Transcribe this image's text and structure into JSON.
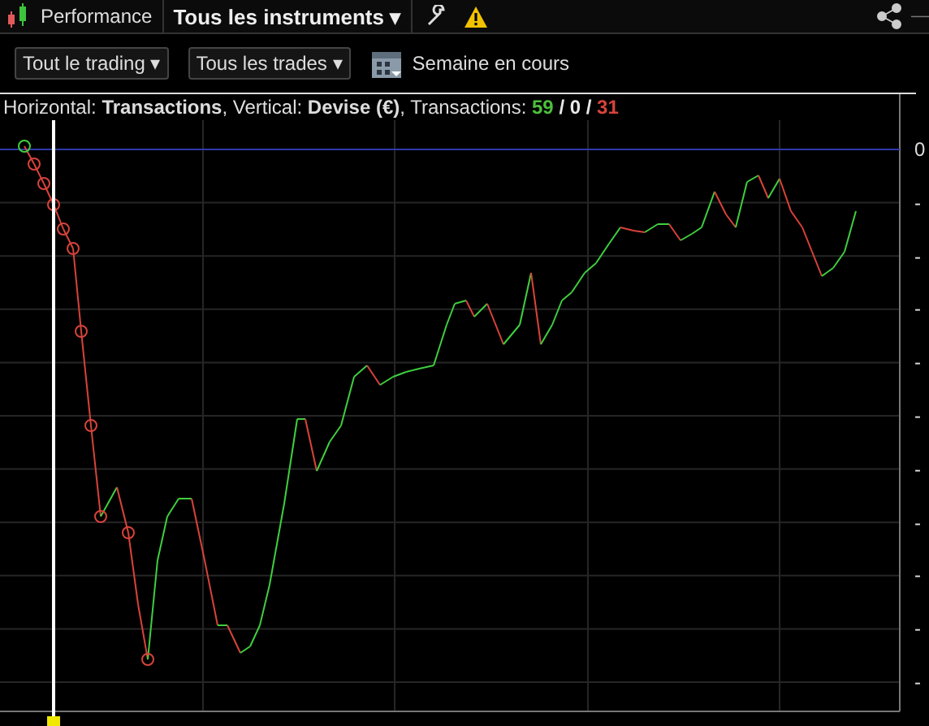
{
  "topbar": {
    "title": "Performance",
    "instrument": "Tous les instruments ▾",
    "dash": "—"
  },
  "filters": [
    {
      "label": "Tout le trading ▾"
    },
    {
      "label": "Tous les trades ▾"
    }
  ],
  "period": "Semaine en cours",
  "legend": {
    "text": "Horizontal: **Transactions**, Vertical: **Devise (€)**, Transactions:",
    "counts": [
      {
        "text": "59",
        "color": "#4cbf3c"
      },
      {
        "text": "/ 0 /",
        "color": "#e8e8e8"
      },
      {
        "text": "31",
        "color": "#d8433a"
      }
    ]
  },
  "y_axis": [
    "0",
    "-",
    "-",
    "-",
    "-",
    "-",
    "-",
    "-",
    "-",
    "-",
    "-"
  ]
}
